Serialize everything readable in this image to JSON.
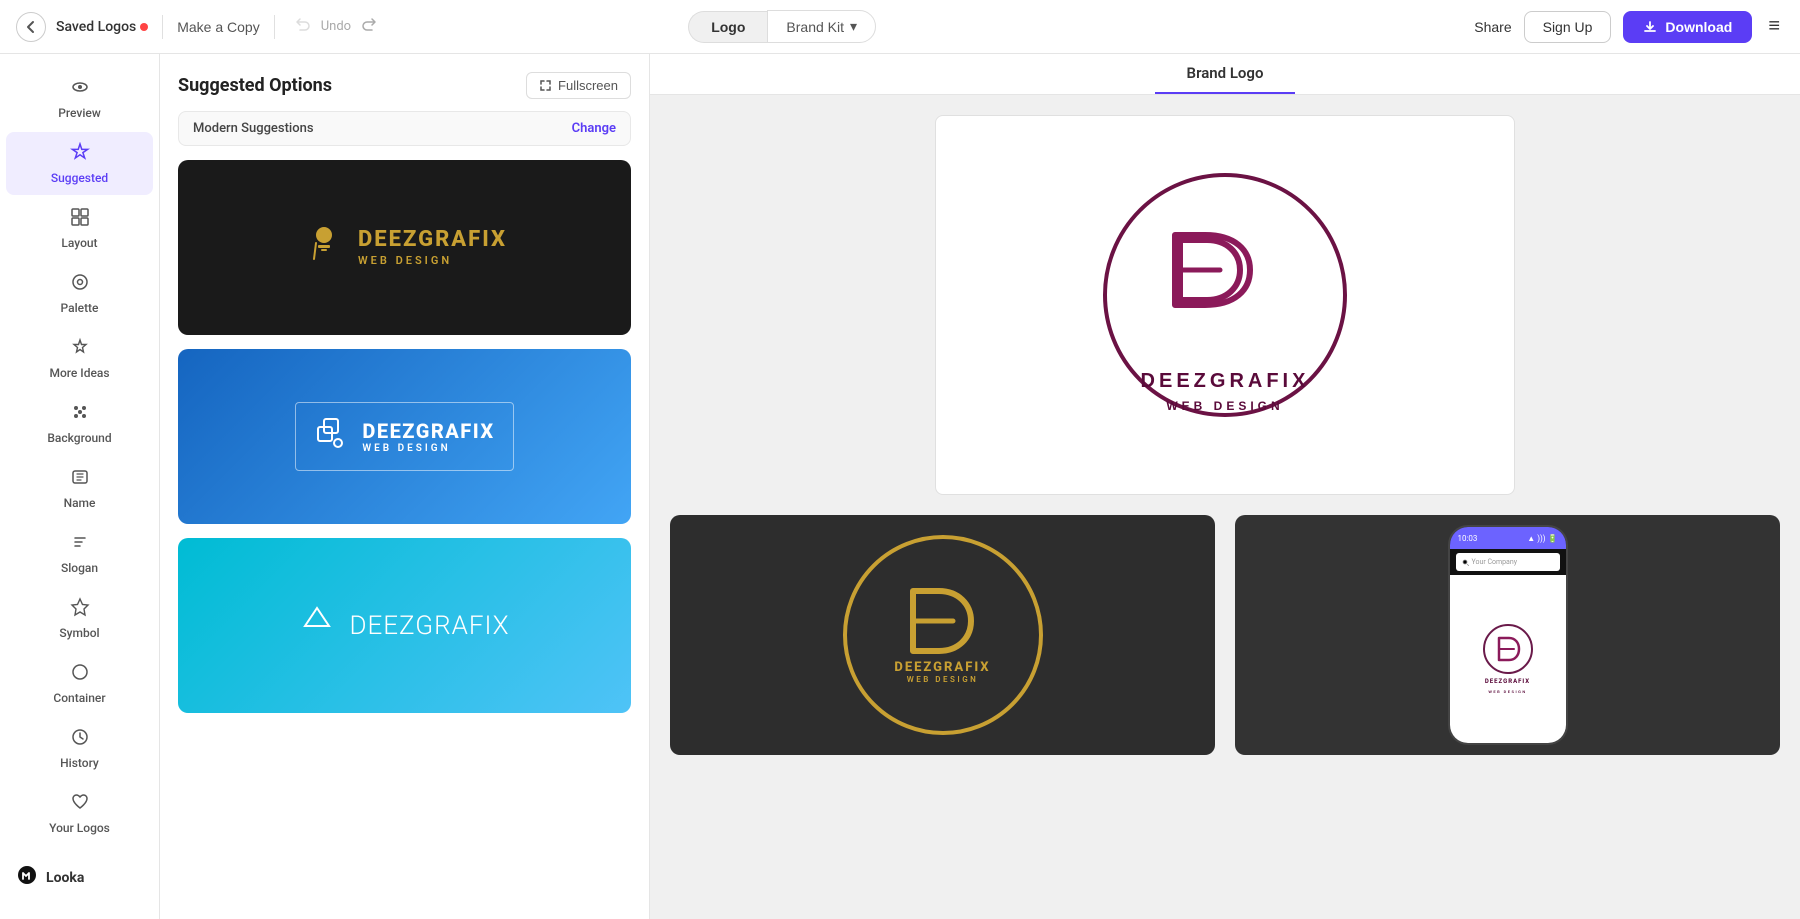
{
  "topnav": {
    "back_label": "‹",
    "saved_logos_label": "Saved Logos",
    "make_copy_label": "Make a Copy",
    "undo_label": "Undo",
    "redo_label": "↺",
    "logo_tab_label": "Logo",
    "brand_kit_label": "Brand Kit",
    "brand_kit_chevron": "▾",
    "share_label": "Share",
    "signup_label": "Sign Up",
    "download_label": "Download",
    "menu_label": "≡"
  },
  "sidebar": {
    "items": [
      {
        "id": "preview",
        "label": "Preview",
        "icon": "👁"
      },
      {
        "id": "suggested",
        "label": "Suggested",
        "icon": "✦",
        "active": true
      },
      {
        "id": "layout",
        "label": "Layout",
        "icon": "⊞"
      },
      {
        "id": "palette",
        "label": "Palette",
        "icon": "◎"
      },
      {
        "id": "more-ideas",
        "label": "More Ideas",
        "icon": "✧"
      },
      {
        "id": "background",
        "label": "Background",
        "icon": "⁙"
      },
      {
        "id": "name",
        "label": "Name",
        "icon": "🅰"
      },
      {
        "id": "slogan",
        "label": "Slogan",
        "icon": "A"
      },
      {
        "id": "symbol",
        "label": "Symbol",
        "icon": "✦"
      },
      {
        "id": "container",
        "label": "Container",
        "icon": "○"
      },
      {
        "id": "history",
        "label": "History",
        "icon": "⏱"
      },
      {
        "id": "your-logos",
        "label": "Your Logos",
        "icon": "♡"
      }
    ],
    "brand_label": "Looka"
  },
  "panel": {
    "title": "Suggested Options",
    "fullscreen_label": "Fullscreen",
    "filter_label": "Modern Suggestions",
    "change_label": "Change"
  },
  "brand_logo_tab": {
    "label": "Brand Logo"
  },
  "logo_name": "DEEZGRAFIX",
  "logo_tagline": "WEB DESIGN",
  "mockup": {
    "phone_time": "10:03",
    "phone_placeholder": "Your Company"
  }
}
